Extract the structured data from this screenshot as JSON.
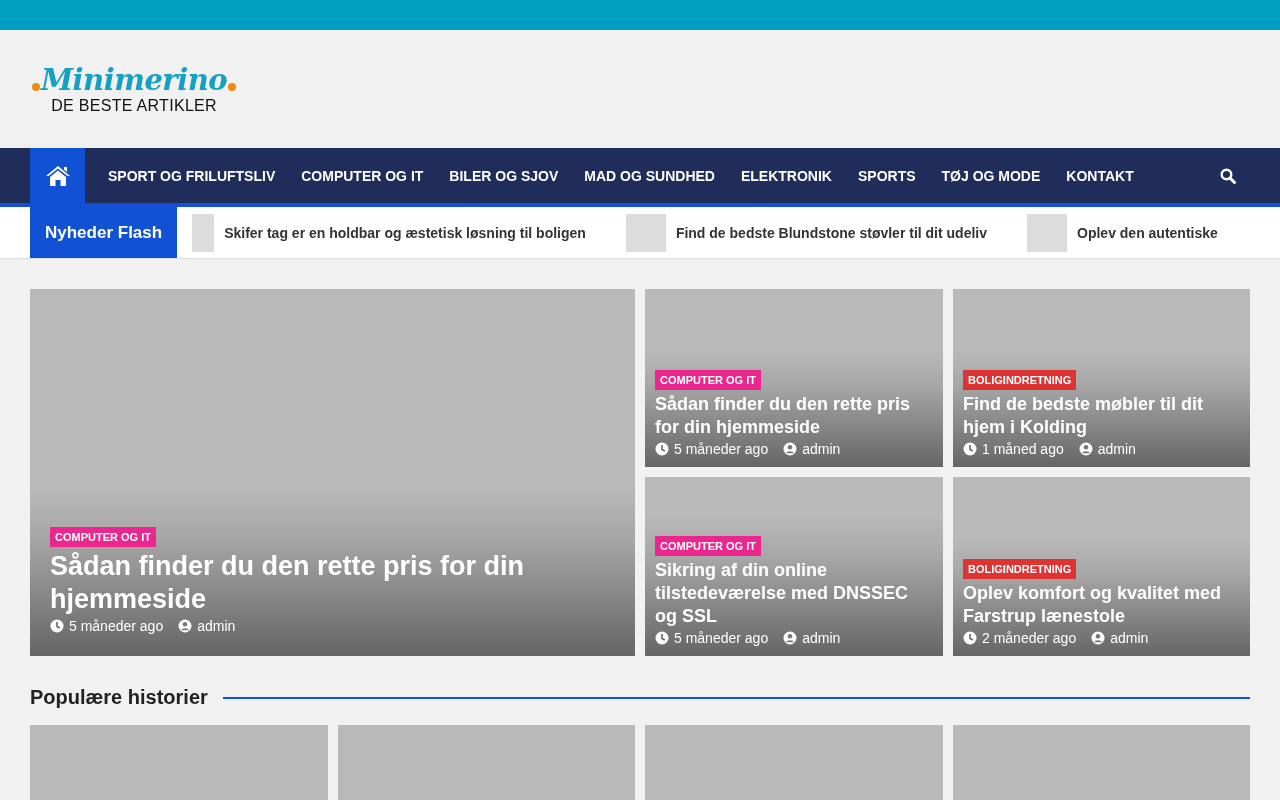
{
  "logo": {
    "name": "Minimerino",
    "tagline": "DE BESTE ARTIKLER"
  },
  "nav": {
    "items": [
      "SPORT OG FRILUFTSLIV",
      "COMPUTER OG IT",
      "BILER OG SJOV",
      "MAD OG SUNDHED",
      "ELEKTRONIK",
      "SPORTS",
      "TØJ OG MODE",
      "KONTAKT"
    ]
  },
  "ticker": {
    "label": "Nyheder Flash",
    "items": [
      "Skifer tag er en holdbar og æstetisk løsning til boligen",
      "Find de bedste Blundstone støvler til dit udeliv",
      "Oplev den autentiske"
    ]
  },
  "featured": [
    {
      "category": "COMPUTER OG IT",
      "color": "#ec268f",
      "title": "Sådan finder du den rette pris for din hjemmeside",
      "time": "5 måneder ago",
      "author": "admin"
    },
    {
      "category": "COMPUTER OG IT",
      "color": "#ec268f",
      "title": "Sådan finder du den rette pris for din hjemmeside",
      "time": "5 måneder ago",
      "author": "admin"
    },
    {
      "category": "BOLIGINDRETNING",
      "color": "#dd3333",
      "title": "Find de bedste møbler til dit hjem i Kolding",
      "time": "1 måned ago",
      "author": "admin"
    },
    {
      "category": "COMPUTER OG IT",
      "color": "#ec268f",
      "title": "Sikring af din online tilstedeværelse med DNSSEC og SSL",
      "time": "5 måneder ago",
      "author": "admin"
    },
    {
      "category": "BOLIGINDRETNING",
      "color": "#dd3333",
      "title": "Oplev komfort og kvalitet med Farstrup lænestole",
      "time": "2 måneder ago",
      "author": "admin"
    }
  ],
  "popular": {
    "heading": "Populære historier"
  }
}
